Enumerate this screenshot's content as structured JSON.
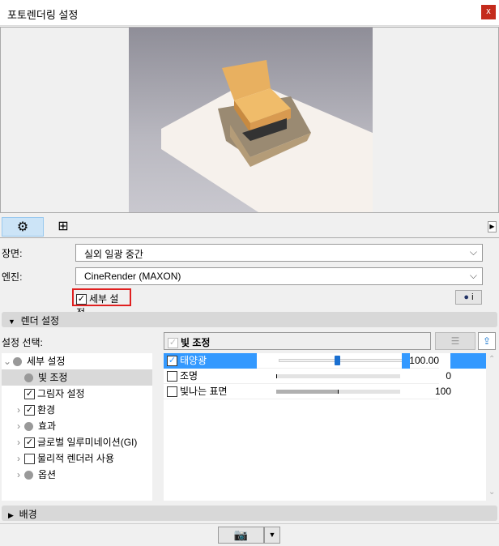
{
  "window": {
    "title": "포토렌더링 설정",
    "close": "x"
  },
  "toolbar": {
    "settings_tab_icon": "gear-icon",
    "size_tab_icon": "size-grid-icon",
    "expand": "▶"
  },
  "scene": {
    "label": "장면:",
    "value": "실외 일광 중간"
  },
  "engine": {
    "label": "엔진:",
    "value": "CineRender (MAXON)"
  },
  "detail": {
    "label": "세부 설정",
    "checked": true
  },
  "cinema_info": "i",
  "render_settings": {
    "label": "렌더 설정"
  },
  "select_label": "설정 선택:",
  "tree": [
    {
      "label": "세부 설정",
      "type": "dot",
      "expander": "v"
    },
    {
      "label": "빛 조정",
      "type": "dot",
      "selected": true
    },
    {
      "label": "그림자 설정",
      "type": "check",
      "checked": true
    },
    {
      "label": "환경",
      "type": "check",
      "checked": true,
      "expander": ">"
    },
    {
      "label": "효과",
      "type": "dot",
      "expander": ">"
    },
    {
      "label": "글로벌 일루미네이션(GI)",
      "type": "check",
      "checked": true,
      "expander": ">"
    },
    {
      "label": "물리적 렌더러 사용",
      "type": "check",
      "checked": false,
      "expander": ">"
    },
    {
      "label": "옵션",
      "type": "dot",
      "expander": ">"
    }
  ],
  "panel": {
    "header": "빛 조정",
    "rows": [
      {
        "label": "태양광",
        "checked": true,
        "value": "100.00",
        "percent": 50
      },
      {
        "label": "조명",
        "checked": false,
        "value": "0",
        "percent": 0
      },
      {
        "label": "빛나는 표면",
        "checked": false,
        "value": "100",
        "percent": 50
      }
    ]
  },
  "background": {
    "label": "배경"
  },
  "accent": "#3399ff"
}
